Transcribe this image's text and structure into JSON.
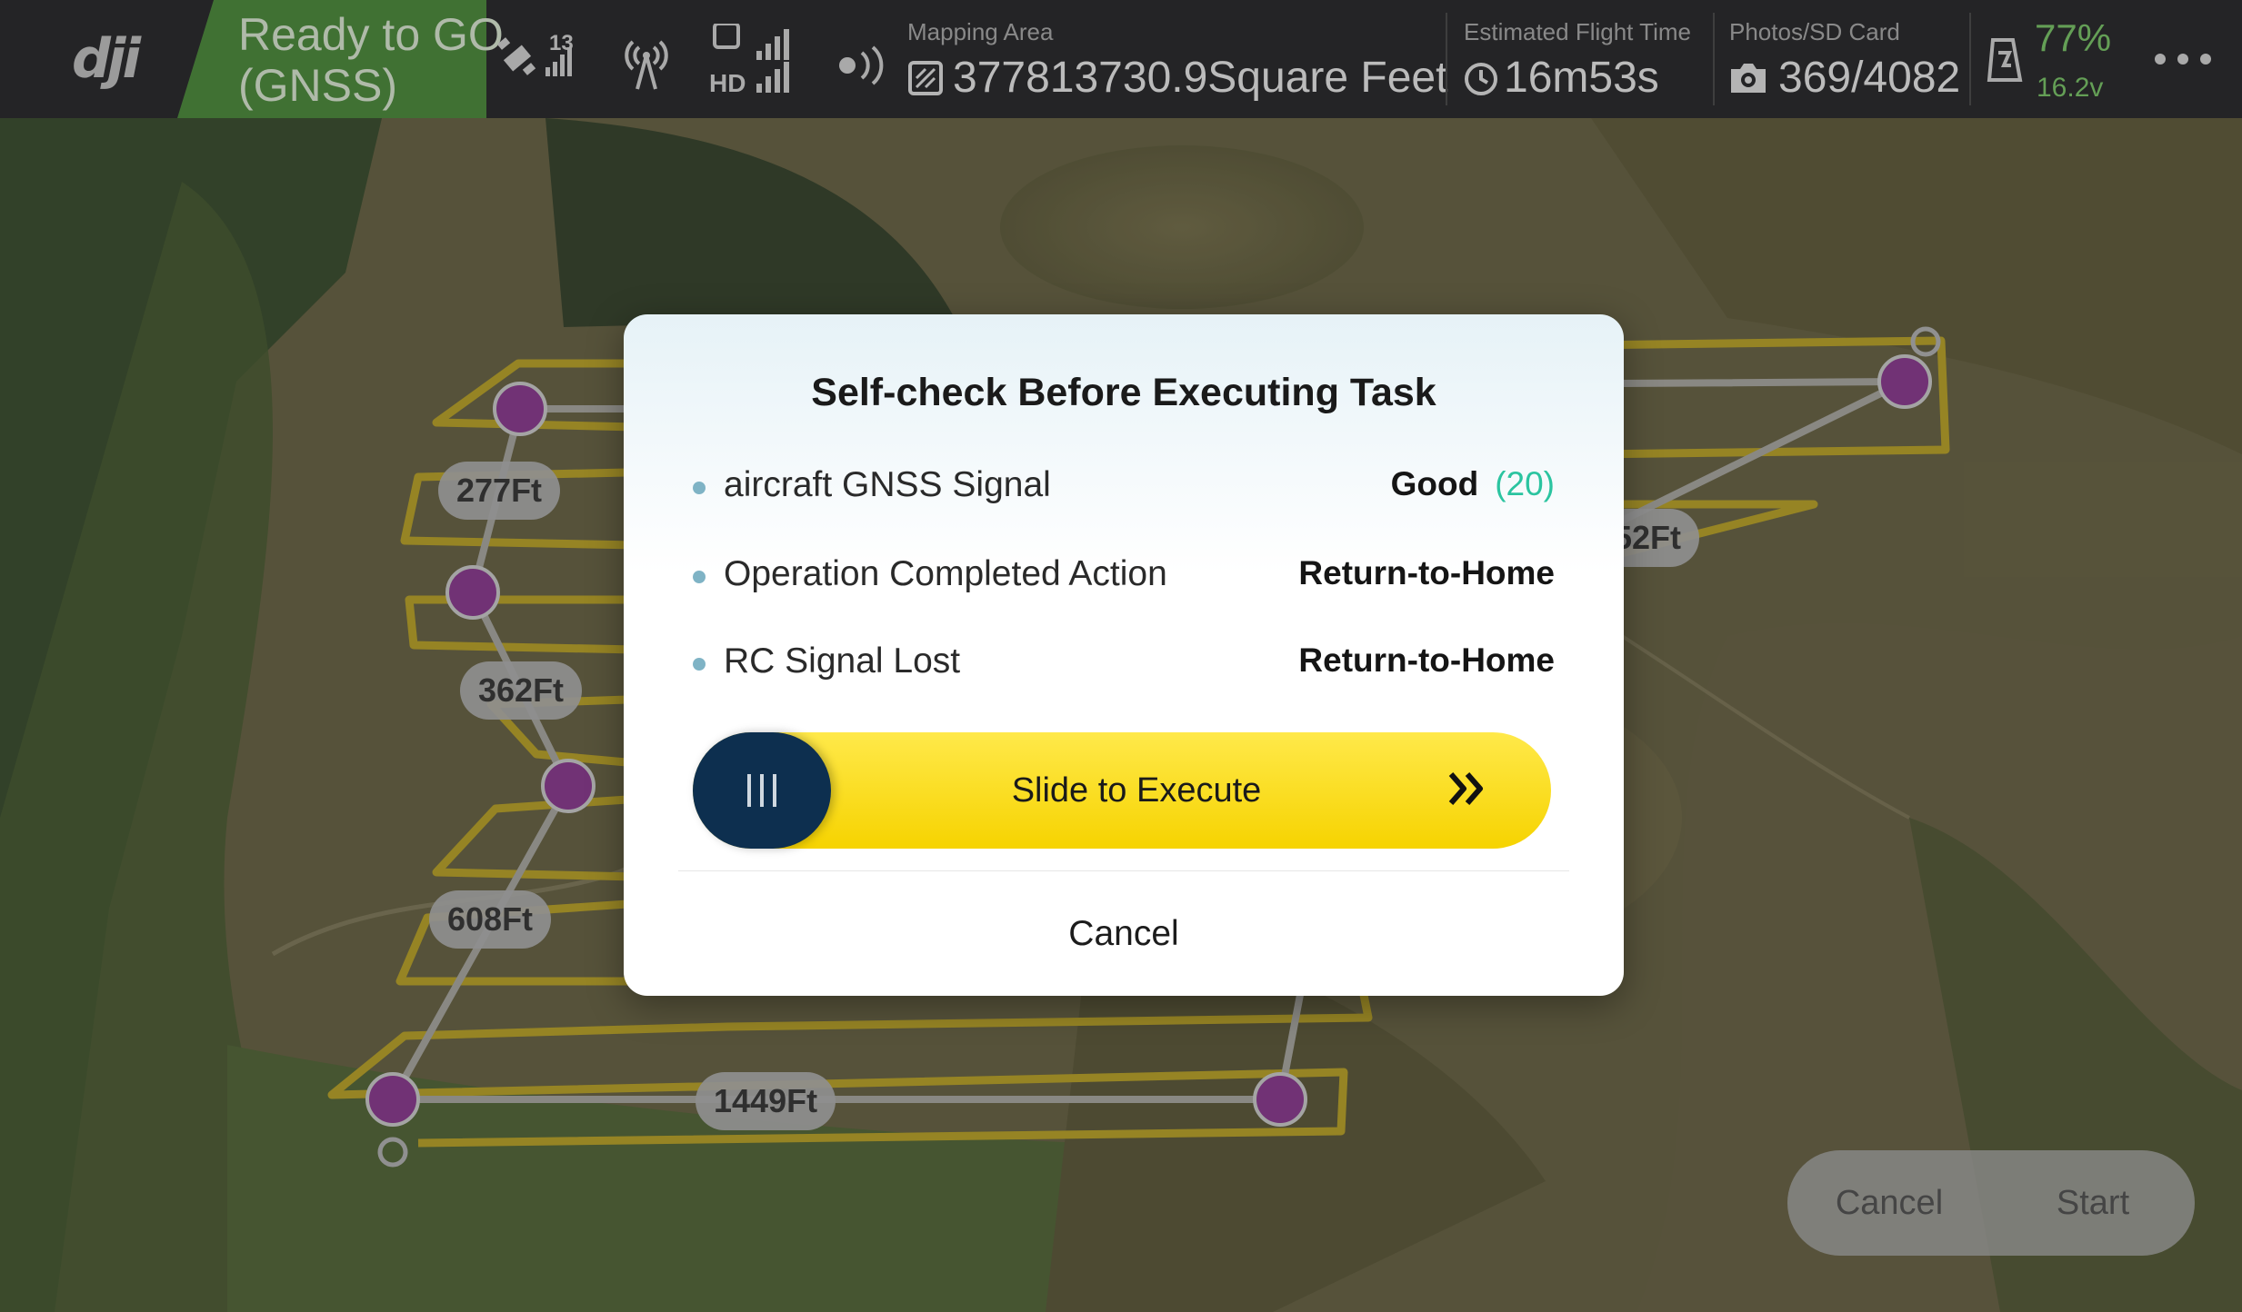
{
  "status_bar": {
    "logo": "dji",
    "flight_status": [
      "Ready to GO",
      "(GNSS)"
    ],
    "satellite_count": "13",
    "video_link_label": "HD",
    "mapping_area_label": "Mapping Area",
    "mapping_area_value": "377813730.9Square Feet",
    "flight_time_label": "Estimated Flight Time",
    "flight_time_value": "16m53s",
    "photos_label": "Photos/SD Card",
    "photos_value": "369/4082",
    "battery_percent": "77%",
    "battery_voltage": "16.2v"
  },
  "map": {
    "distance_labels": [
      "277Ft",
      "362Ft",
      "608Ft",
      "1449Ft",
      "52Ft"
    ],
    "route_color": "#b7a22c",
    "waypoint_color": "#8a3d8f"
  },
  "dialog": {
    "title": "Self-check Before Executing Task",
    "rows": [
      {
        "label": "aircraft GNSS Signal",
        "value": "Good",
        "extra": "(20)"
      },
      {
        "label": "Operation Completed Action",
        "value": "Return-to-Home"
      },
      {
        "label": "RC Signal Lost",
        "value": "Return-to-Home"
      }
    ],
    "slider_label": "Slide to Execute",
    "cancel_label": "Cancel",
    "accent": "#f6d300"
  },
  "bottom_actions": {
    "cancel_label": "Cancel",
    "start_label": "Start"
  }
}
